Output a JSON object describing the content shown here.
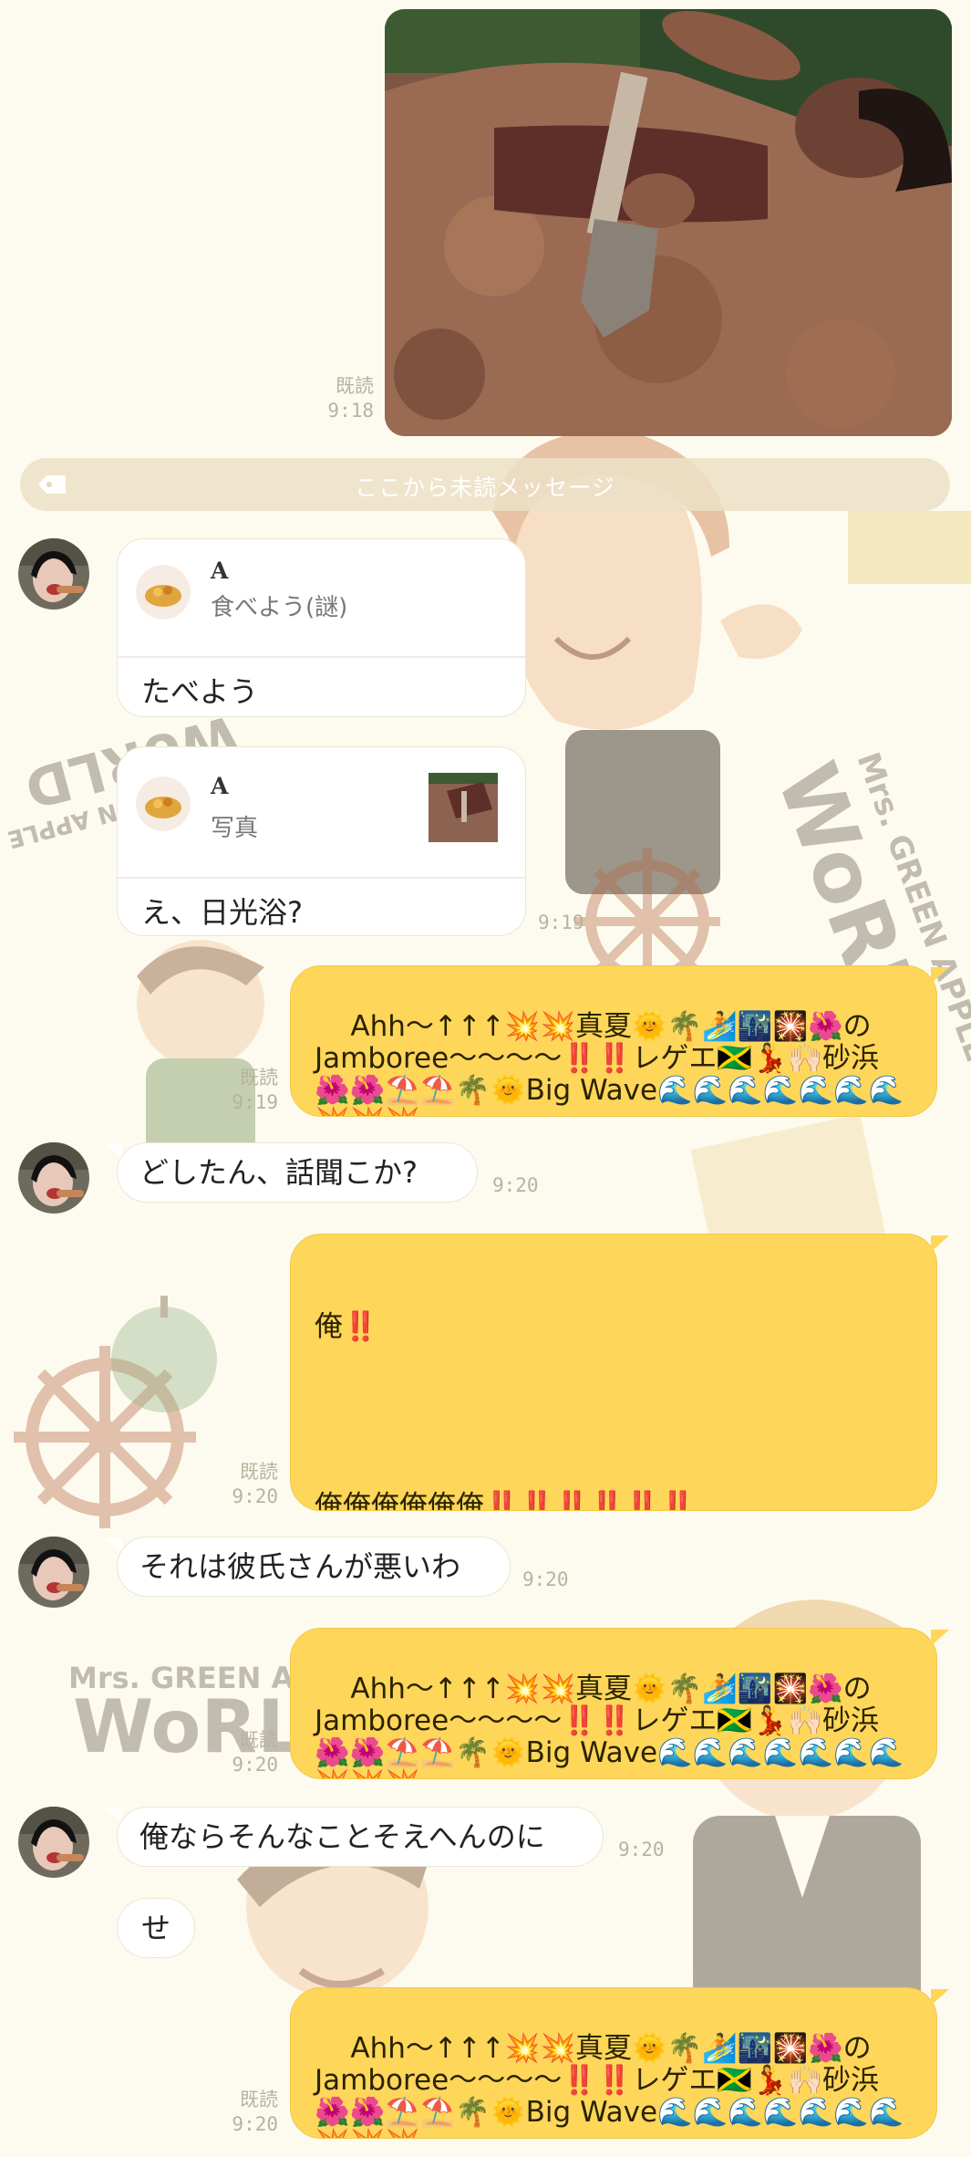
{
  "colors": {
    "background": "#fdfbef",
    "my_bubble": "#fed65a",
    "their_bubble": "#ffffff",
    "timestamp": "#b8b2a0",
    "unread_bar": "#ece0c6"
  },
  "sent_photo": {
    "read_label": "既読",
    "time": "9:18"
  },
  "unread_divider": {
    "label": "ここから未読メッセージ",
    "icon": "tag-icon"
  },
  "replies": [
    {
      "name": "A",
      "quote": "食べよう(謎)",
      "text": "たべよう"
    },
    {
      "name": "A",
      "quote": "写真",
      "text": "え、日光浴?",
      "time": "9:19"
    }
  ],
  "jamboree_text": "Ahh〜↑↑↑💥💥真夏🌞🌴🏄🌃🎇🌺の Jamboree〜〜〜〜‼️‼️レゲエ🇯🇲💃🙌🏻砂浜🌺🌺⛱️⛱️🌴🌞Big Wave🌊🌊🌊🌊🌊🌊🌊💥💥💥",
  "messages": {
    "m3": {
      "read_label": "既読",
      "time": "9:19"
    },
    "m4": {
      "text": "どしたん、話聞こか?",
      "time": "9:20"
    },
    "m5": {
      "line1": "俺‼️",
      "line2": "俺俺俺俺俺俺‼️‼️‼️‼️‼️‼️",
      "read_label": "既読",
      "time": "9:20"
    },
    "m6": {
      "text": "それは彼氏さんが悪いわ",
      "time": "9:20"
    },
    "m7": {
      "read_label": "既読",
      "time": "9:20"
    },
    "m8": {
      "text": "俺ならそんなことそえへんのに",
      "time": "9:20"
    },
    "m9": {
      "text": "せ"
    },
    "m10": {
      "read_label": "既読",
      "time": "9:20"
    }
  },
  "background_art": {
    "wordmark_line1": "Mrs. GREEN APPLE",
    "wordmark_line2": "WoRLD"
  }
}
